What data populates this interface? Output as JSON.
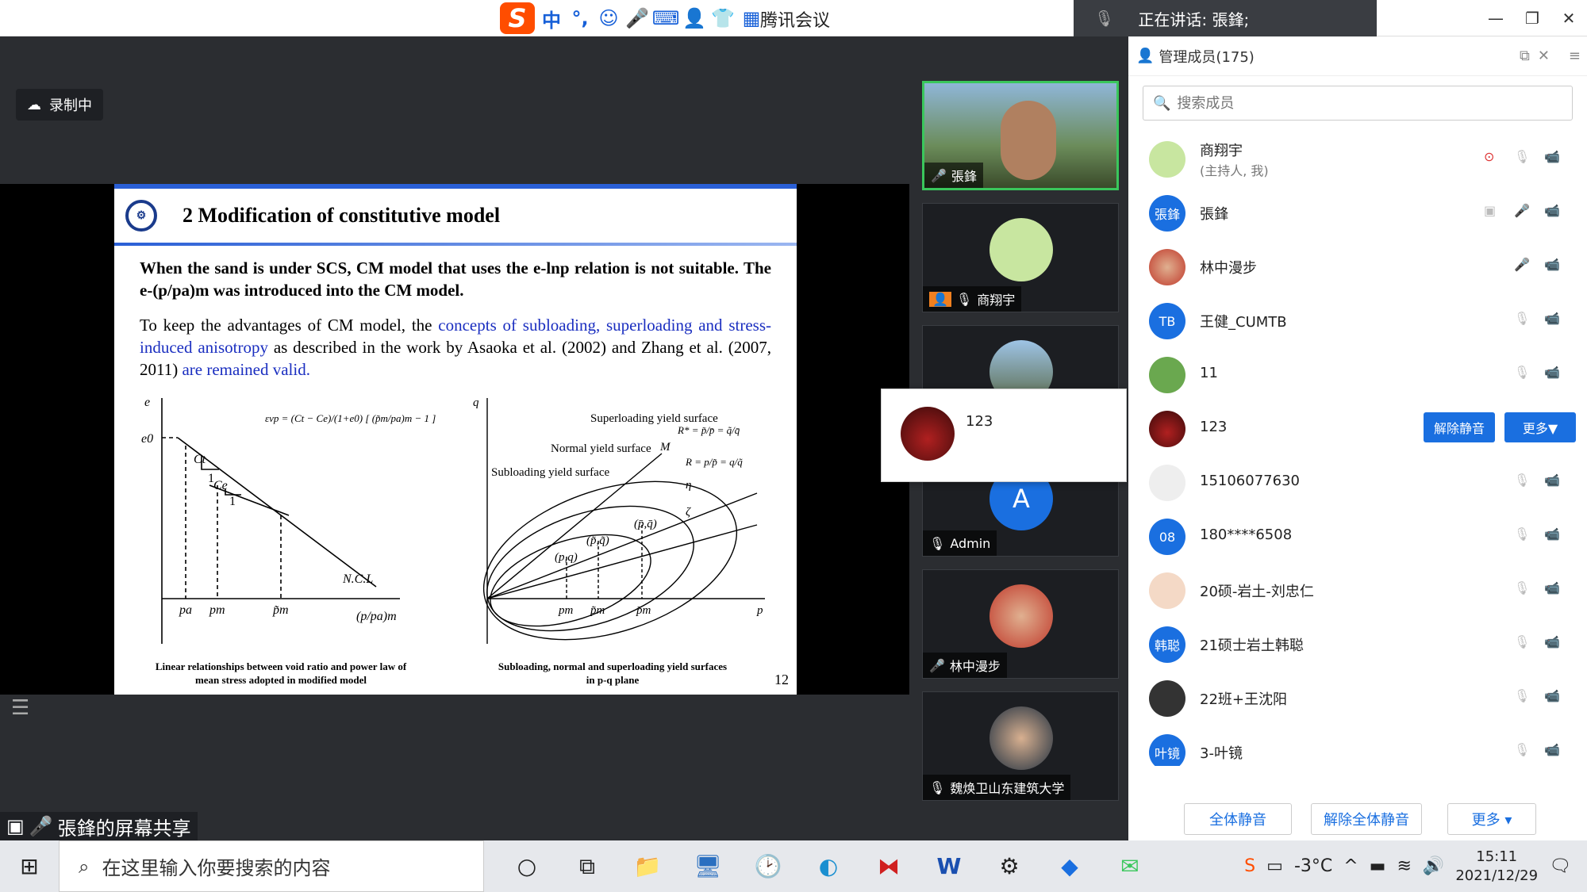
{
  "title_bar": {
    "app_title": "腾讯会议",
    "speaking": "正在讲话: 張鋒;",
    "ime_logo": "S",
    "ime_mode": "中"
  },
  "stage": {
    "recording": "录制中",
    "share_label": "張鋒的屏幕共享"
  },
  "slide": {
    "heading": "2 Modification of constitutive model",
    "para1": "When the sand is under SCS, CM model that uses the e-lnp relation is not suitable. The e-(p/pa)m was introduced into the CM model.",
    "para2_a": "To keep the advantages of CM model, the ",
    "para2_b": "concepts of subloading, superloading and stress-induced anisotropy",
    "para2_c": " as described in the work by Asaoka et al. (2002) and Zhang et al. (2007, 2011) ",
    "para2_d": "are remained valid.",
    "fig1_caption": "Linear relationships between void ratio and power law of mean stress adopted in modified model",
    "fig2_caption": "Subloading, normal and superloading yield surfaces in p-q plane",
    "page_number": "12",
    "fig1": {
      "y_axis": "e",
      "e0": "e0",
      "ct": "Ct",
      "ce": "Ce",
      "one_a": "1",
      "one_b": "1",
      "ncl": "N.C.L",
      "pa": "pa",
      "pm": "pm",
      "pm_tilde": "p̃m",
      "x_axis": "(p/pa)m",
      "formula": "εvp = (Ct − Ce)/(1+e0) [ (p̃m/pa)m − 1 ]"
    },
    "fig2": {
      "y_axis": "q",
      "x_axis": "p",
      "superloading": "Superloading yield surface",
      "normal": "Normal yield surface",
      "subloading": "Subloading yield surface",
      "m": "M",
      "eta": "η",
      "zeta": "ζ",
      "pt_sub": "(p,q)",
      "pt_norm": "(p̃,q̃)",
      "pt_super": "(p̄,q̄)",
      "r_star": "R* = p̃/p̄ = q̃/q̄",
      "r": "R = p/p̃ = q/q̃",
      "x1": "pm",
      "x2": "p̃m",
      "x3": "p̄m"
    }
  },
  "video_tiles": [
    {
      "name": "張鋒",
      "mic": "on"
    },
    {
      "name": "商翔宇",
      "mic": "off"
    },
    {
      "name": "",
      "mic": "none"
    },
    {
      "name": "Admin",
      "mic": "off",
      "initial": "A"
    },
    {
      "name": "林中漫步",
      "mic": "on"
    },
    {
      "name": "魏焕卫山东建筑大学",
      "mic": "off"
    }
  ],
  "popup": {
    "name": "123"
  },
  "panel": {
    "title": "管理成员(175)",
    "search_placeholder": "搜索成员",
    "members": [
      {
        "name": "商翔宇",
        "sub": "(主持人, 我)",
        "avatar": "",
        "color": "#c8e6a0"
      },
      {
        "name": "張鋒",
        "sub": "",
        "avatar": "張鋒",
        "color": "#1a6fe0"
      },
      {
        "name": "林中漫步",
        "sub": "",
        "avatar": "",
        "color": "#c0392b"
      },
      {
        "name": "王健_CUMTB",
        "sub": "",
        "avatar": "TB",
        "color": "#1a6fe0"
      },
      {
        "name": "11",
        "sub": "",
        "avatar": "",
        "color": "#6aa84f"
      },
      {
        "name": "123",
        "sub": "",
        "avatar": "",
        "color": "#7a1a1a"
      },
      {
        "name": "15106077630",
        "sub": "",
        "avatar": "",
        "color": "#eeeeee"
      },
      {
        "name": "180****6508",
        "sub": "",
        "avatar": "08",
        "color": "#1a6fe0"
      },
      {
        "name": "20硕-岩土-刘忠仁",
        "sub": "",
        "avatar": "",
        "color": "#f4d9c6"
      },
      {
        "name": "21硕士岩土韩聪",
        "sub": "",
        "avatar": "韩聪",
        "color": "#1a6fe0"
      },
      {
        "name": "22班+王沈阳",
        "sub": "",
        "avatar": "",
        "color": "#333333"
      },
      {
        "name": "3-叶镜",
        "sub": "",
        "avatar": "叶镜",
        "color": "#1a6fe0"
      }
    ],
    "unmute_btn": "解除静音",
    "more_btn": "更多▼",
    "footer": {
      "mute_all": "全体静音",
      "unmute_all": "解除全体静音",
      "more": "更多 ▾"
    }
  },
  "taskbar": {
    "search_placeholder": "在这里输入你要搜索的内容",
    "temp": "-3°C",
    "time": "15:11",
    "date": "2021/12/29"
  }
}
